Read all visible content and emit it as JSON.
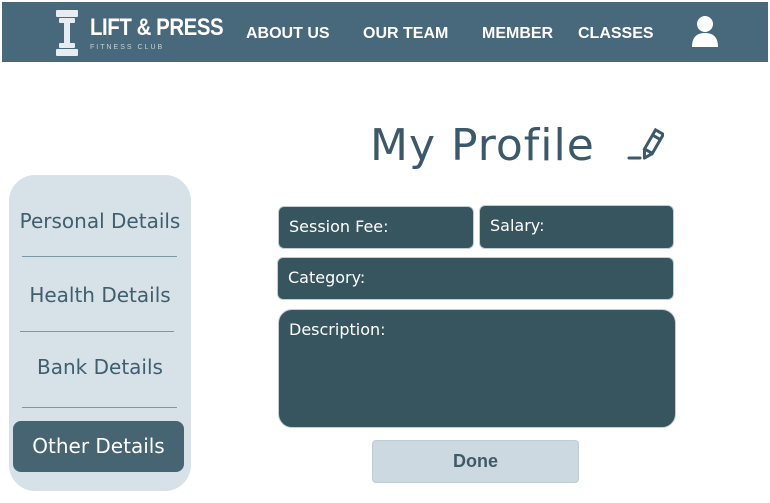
{
  "brand": {
    "name": "LIFT & PRESS",
    "tagline": "FITNESS CLUB"
  },
  "nav": {
    "items": [
      {
        "label": "ABOUT US"
      },
      {
        "label": "OUR TEAM"
      },
      {
        "label": "MEMBER"
      },
      {
        "label": "CLASSES"
      }
    ],
    "user_icon": "user-icon"
  },
  "page": {
    "title": "My Profile",
    "edit_icon": "pencil-icon"
  },
  "sidebar": {
    "items": [
      {
        "label": "Personal Details"
      },
      {
        "label": "Health Details"
      },
      {
        "label": "Bank Details"
      },
      {
        "label": "Other Details",
        "active": true
      }
    ]
  },
  "form": {
    "session_fee_label": "Session Fee:",
    "salary_label": "Salary:",
    "category_label": "Category:",
    "description_label": "Description:",
    "done_label": "Done"
  },
  "colors": {
    "navbar": "#48687c",
    "accent_dark": "#37555f",
    "sidebar_bg": "#d6e2e8",
    "button_bg": "#ccd9e0"
  }
}
